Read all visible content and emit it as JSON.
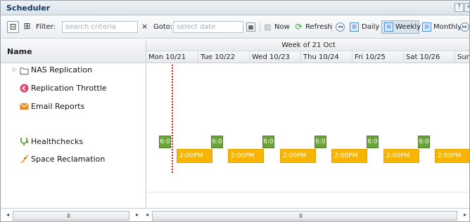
{
  "window": {
    "title": "Scheduler",
    "help": "?",
    "close": "×"
  },
  "toolbar": {
    "collapse_symbol": "⊟",
    "expand_symbol": "⊞",
    "filter_label": "Filter:",
    "filter_placeholder": "search criteria",
    "clear_symbol": "×",
    "goto_label": "Goto:",
    "goto_placeholder": "select date",
    "now_label": "Now",
    "refresh_label": "Refresh",
    "daily_label": "Daily",
    "weekly_label": "Weekly",
    "monthly_label": "Monthly",
    "active_view": "Weekly"
  },
  "grid": {
    "name_header": "Name",
    "week_label": "Week of 21 Oct",
    "days": [
      "Mon 10/21",
      "Tue 10/22",
      "Wed 10/23",
      "Thu 10/24",
      "Fri 10/25",
      "Sat 10/26",
      "Sun"
    ]
  },
  "rows": [
    {
      "label": "NAS Replication",
      "icon": "folder-icon",
      "has_expander": true
    },
    {
      "label": "Replication Throttle",
      "icon": "throttle-icon",
      "color": "#e8446a"
    },
    {
      "label": "Email Reports",
      "icon": "email-icon",
      "color": "#f08a17"
    },
    {
      "label": "Healthchecks",
      "icon": "stethoscope-icon",
      "color": "#4e9a2b"
    },
    {
      "label": "Space Reclamation",
      "icon": "broom-icon",
      "color": "#e6a300"
    }
  ],
  "events": {
    "healthchecks_label": "6:0",
    "reclamation_label": "2:00PM"
  },
  "colors": {
    "accent": "#15355a",
    "healthcheck": "#6aa338",
    "reclamation": "#f7b400",
    "now_line": "#d11111"
  },
  "scrollbar": {
    "grip": "III",
    "left": "◂",
    "right": "▸"
  }
}
